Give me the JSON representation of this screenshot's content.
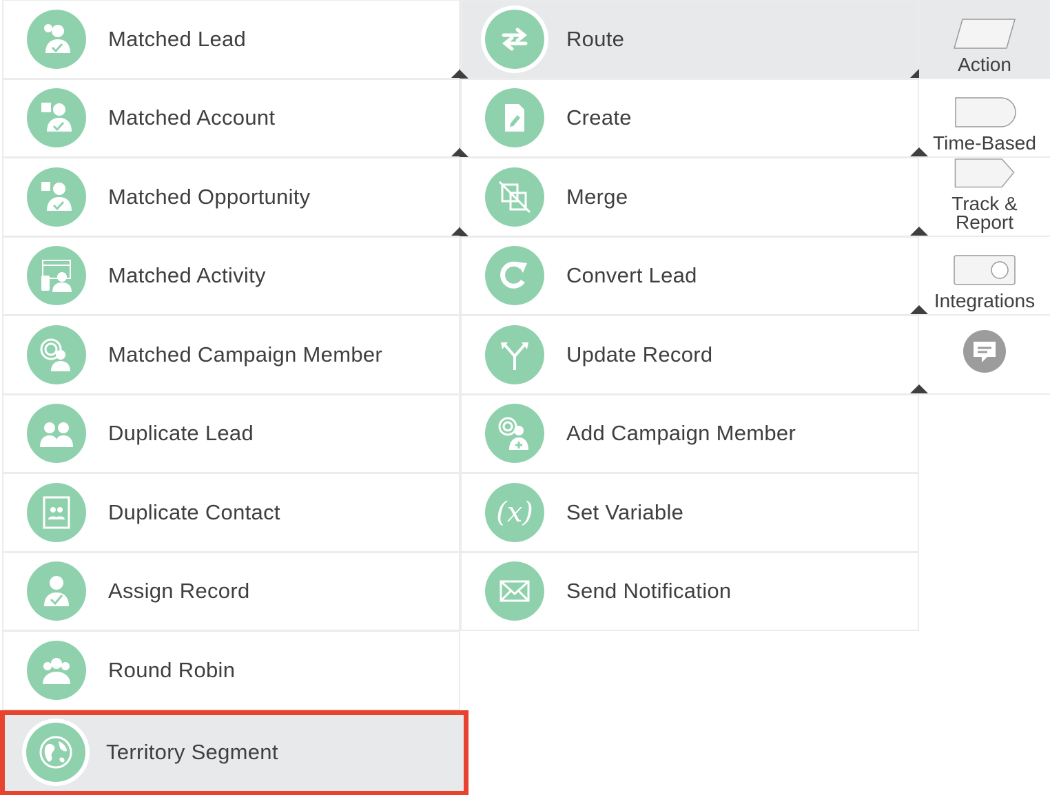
{
  "left_items": [
    {
      "label": "Matched Lead",
      "icon": "person-check-icon"
    },
    {
      "label": "Matched Account",
      "icon": "building-person-icon"
    },
    {
      "label": "Matched Opportunity",
      "icon": "opportunity-person-icon"
    },
    {
      "label": "Matched Activity",
      "icon": "calendar-person-icon"
    },
    {
      "label": "Matched Campaign Member",
      "icon": "target-person-icon"
    },
    {
      "label": "Duplicate Lead",
      "icon": "two-people-icon"
    },
    {
      "label": "Duplicate Contact",
      "icon": "contact-book-icon"
    },
    {
      "label": "Assign Record",
      "icon": "person-check-icon"
    },
    {
      "label": "Round Robin",
      "icon": "group-icon"
    },
    {
      "label": "Territory Segment",
      "icon": "globe-icon",
      "highlighted": true
    }
  ],
  "mid_items": [
    {
      "label": "Route",
      "icon": "swap-arrows-icon",
      "selected": true
    },
    {
      "label": "Create",
      "icon": "document-pencil-icon"
    },
    {
      "label": "Merge",
      "icon": "merge-icon"
    },
    {
      "label": "Convert Lead",
      "icon": "refresh-icon"
    },
    {
      "label": "Update Record",
      "icon": "split-arrows-icon"
    },
    {
      "label": "Add Campaign Member",
      "icon": "target-person-add-icon"
    },
    {
      "label": "Set Variable",
      "icon": "variable-icon",
      "glyph": "(x)"
    },
    {
      "label": "Send Notification",
      "icon": "envelope-icon"
    }
  ],
  "side_items": [
    {
      "label": "Action",
      "icon": "parallelogram-icon",
      "active": true
    },
    {
      "label": "Time-Based",
      "icon": "rounded-rect-icon"
    },
    {
      "label": "Track & Report",
      "icon": "tag-shape-icon"
    },
    {
      "label": "Integrations",
      "icon": "toggle-icon"
    },
    {
      "label": "",
      "icon": "chat-bubble-icon"
    }
  ],
  "colors": {
    "icon_bg": "#8fd1ad",
    "selected_bg": "#e8e9eb",
    "highlight_border": "#e8432e",
    "text": "#3f3f3f"
  }
}
